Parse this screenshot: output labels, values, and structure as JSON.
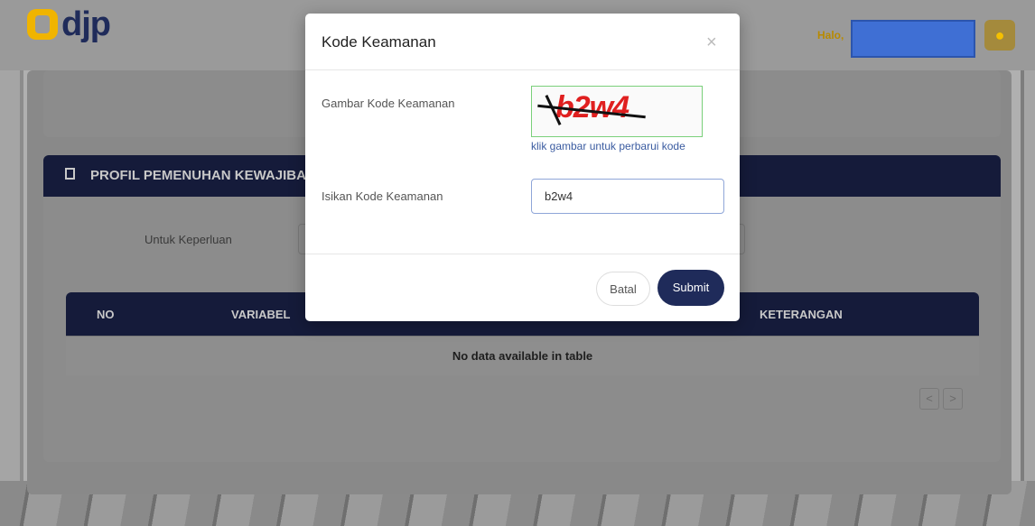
{
  "header": {
    "logo_text": "djp",
    "greeting": "Halo,",
    "avatar_icon": "user-icon",
    "accent_color": "#f0b400",
    "brand_color": "#1f2b5a"
  },
  "section": {
    "title": "PROFIL PEMENUHAN KEWAJIBA",
    "icon": "document-icon",
    "filter_label": "Untuk Keperluan"
  },
  "table": {
    "columns": [
      "NO",
      "VARIABEL",
      "KETERANGAN"
    ],
    "empty_text": "No data available in table"
  },
  "pager": {
    "prev_label": "<",
    "next_label": ">"
  },
  "modal": {
    "title": "Kode Keamanan",
    "close_label": "×",
    "captcha_label": "Gambar Kode Keamanan",
    "captcha_text": "b2w4",
    "captcha_hint": "klik gambar untuk perbarui kode",
    "input_label": "Isikan Kode Keamanan",
    "input_value": "b2w4",
    "cancel_label": "Batal",
    "submit_label": "Submit"
  }
}
